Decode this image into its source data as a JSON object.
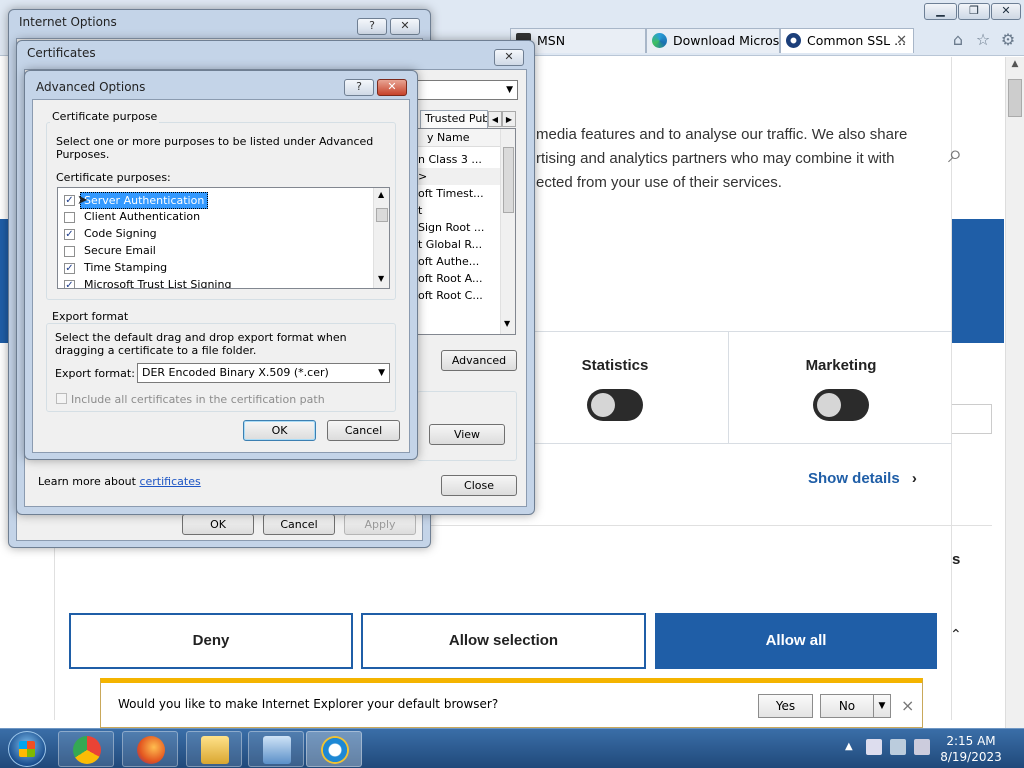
{
  "browser": {
    "tabs": [
      {
        "label": "MSN",
        "icon": "msn-icon"
      },
      {
        "label": "Download Micros...",
        "icon": "edge-icon"
      },
      {
        "label": "Common SSL ...",
        "icon": "ssl-site-icon"
      }
    ],
    "window_controls": {
      "minimize": "▁",
      "maximize": "❐",
      "close": "✕"
    }
  },
  "page": {
    "cookie_text_lines": [
      "media features and to analyse our traffic. We also share",
      "rtising and analytics partners who may combine it with",
      "ected from your use of their services."
    ],
    "toggles": [
      {
        "label": "Statistics",
        "on": false
      },
      {
        "label": "Marketing",
        "on": false
      }
    ],
    "show_details": "Show details",
    "buttons": {
      "deny": "Deny",
      "allow_selection": "Allow selection",
      "allow_all": "Allow all"
    },
    "partial_s": "s",
    "accent": "#1f5ea7"
  },
  "notification": {
    "message": "Would you like to make Internet Explorer your default browser?",
    "yes": "Yes",
    "no": "No",
    "close": "×"
  },
  "internet_options": {
    "title": "Internet Options",
    "help": "?",
    "close": "✕",
    "ok": "OK",
    "cancel": "Cancel",
    "apply": "Apply"
  },
  "certificates": {
    "title": "Certificates",
    "close": "✕",
    "tab_trusted": "Trusted Publ",
    "column_header": "y Name",
    "list_items": [
      "n Class 3 ...",
      ">",
      "oft Timest...",
      "t",
      "Sign Root ...",
      "t Global R...",
      "oft Authe...",
      "oft Root A...",
      "oft Root C..."
    ],
    "advanced": "Advanced",
    "view": "View",
    "learn_more_prefix": "Learn more about ",
    "learn_more_link": "certificates",
    "close_button": "Close"
  },
  "advanced_options": {
    "title": "Advanced Options",
    "help": "?",
    "close": "✕",
    "purpose_group": "Certificate purpose",
    "purpose_desc": "Select one or more purposes to be listed under Advanced Purposes.",
    "purposes_label": "Certificate purposes:",
    "purposes": [
      {
        "label": "Server Authentication",
        "checked": true,
        "selected": true
      },
      {
        "label": "Client Authentication",
        "checked": false,
        "selected": false
      },
      {
        "label": "Code Signing",
        "checked": true,
        "selected": false
      },
      {
        "label": "Secure Email",
        "checked": false,
        "selected": false
      },
      {
        "label": "Time Stamping",
        "checked": true,
        "selected": false
      },
      {
        "label": "Microsoft Trust List Signing",
        "checked": true,
        "selected": false
      }
    ],
    "export_group": "Export format",
    "export_desc": "Select the default drag and drop export format when dragging a certificate to a file folder.",
    "export_label": "Export format:",
    "export_value": "DER Encoded Binary X.509 (*.cer)",
    "include_all": "Include all certificates in the certification path",
    "ok": "OK",
    "cancel": "Cancel"
  },
  "taskbar": {
    "time": "2:15 AM",
    "date": "8/19/2023"
  }
}
